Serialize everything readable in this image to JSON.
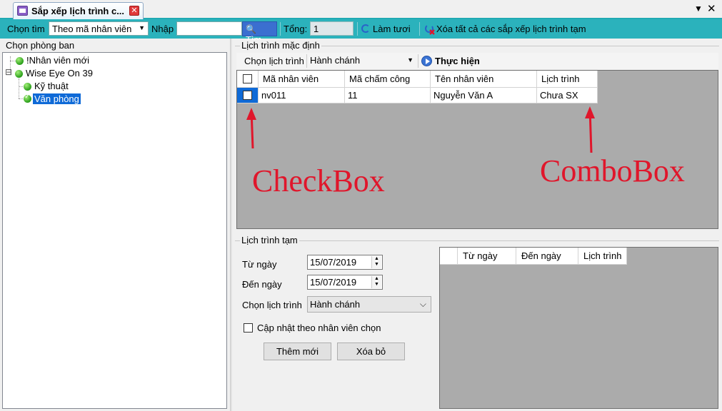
{
  "window": {
    "tab_title": "Sắp xếp lịch trình c...",
    "close_glyph": "✕",
    "menu_glyph": "▼",
    "window_close_glyph": "✕"
  },
  "toolbar": {
    "search_by_label": "Chọn tìm",
    "search_by_value": "Theo mã nhân viên",
    "keyword_label": "Nhập",
    "keyword_value": "",
    "search_button": "Tìm",
    "total_label": "Tổng:",
    "total_value": "1",
    "refresh_label": "Làm tươi",
    "clear_label": "Xóa tất cả các sắp xếp lịch trình tạm"
  },
  "left_panel": {
    "header": "Chọn phòng ban",
    "tree": [
      "!Nhân viên mới",
      "Wise Eye On 39",
      "Kỹ thuật",
      "Văn phòng"
    ],
    "expander_glyph": "⊟"
  },
  "default_schedule": {
    "legend": "Lịch trình mặc định",
    "choose_label": "Chọn lịch trình",
    "schedule_value": "Hành chánh",
    "execute_label": "Thực hiện",
    "columns": [
      "Mã nhân viên",
      "Mã chấm công",
      "Tên nhân viên",
      "Lịch trình"
    ],
    "rows": [
      {
        "checked": false,
        "employee_id": "nv011",
        "attendance_id": "11",
        "name": "Nguyễn Văn A",
        "schedule": "Chưa SX"
      }
    ]
  },
  "annotations": {
    "checkbox": "CheckBox",
    "combobox": "ComboBox",
    "color": "#e0162b"
  },
  "temp_schedule": {
    "legend": "Lịch trình tạm",
    "from_label": "Từ ngày",
    "from_value": "15/07/2019",
    "to_label": "Đến ngày",
    "to_value": "15/07/2019",
    "choose_label": "Chọn lịch trình",
    "schedule_value": "Hành chánh",
    "update_checkbox_label": "Cập nhật theo nhân viên chọn",
    "add_button": "Thêm mới",
    "delete_button": "Xóa bỏ",
    "columns": [
      "Từ ngày",
      "Đến ngày",
      "Lịch trình"
    ]
  },
  "colors": {
    "toolbar_bg": "#2bb2bc",
    "selection": "#0f6ad7",
    "grid_bg": "#ababab"
  }
}
